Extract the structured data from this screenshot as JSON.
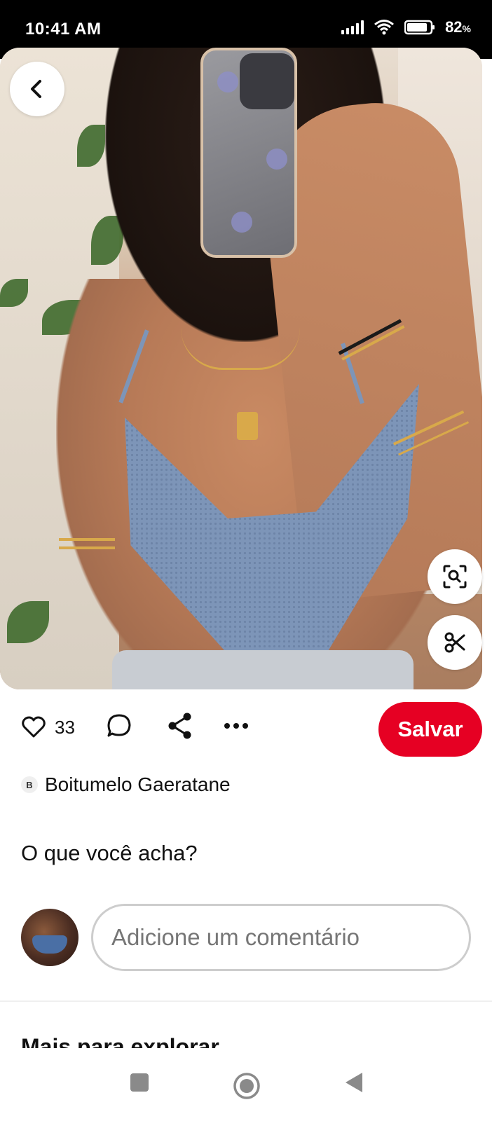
{
  "status_bar": {
    "time": "10:41 AM",
    "battery_percent": "82",
    "battery_unit": "%"
  },
  "pin": {
    "image_alt": "Top de crochê azul",
    "back_icon": "back-arrow-icon",
    "lens_icon": "visual-search-icon",
    "scissors_icon": "scissors-icon"
  },
  "actions": {
    "like_count": "33",
    "like_icon": "heart-icon",
    "comment_icon": "comment-icon",
    "share_icon": "share-icon",
    "more_icon": "more-icon",
    "save_label": "Salvar"
  },
  "author": {
    "initial": "B",
    "name": "Boitumelo Gaeratane"
  },
  "comments": {
    "title": "O que você acha?",
    "input_placeholder": "Adicione um comentário"
  },
  "explore": {
    "title": "Mais para explorar"
  },
  "colors": {
    "save_button": "#e60023",
    "text_primary": "#111111",
    "placeholder": "#767676"
  },
  "nav": {
    "recents_icon": "recents-square-icon",
    "home_icon": "home-circle-icon",
    "back_icon": "back-triangle-icon"
  }
}
